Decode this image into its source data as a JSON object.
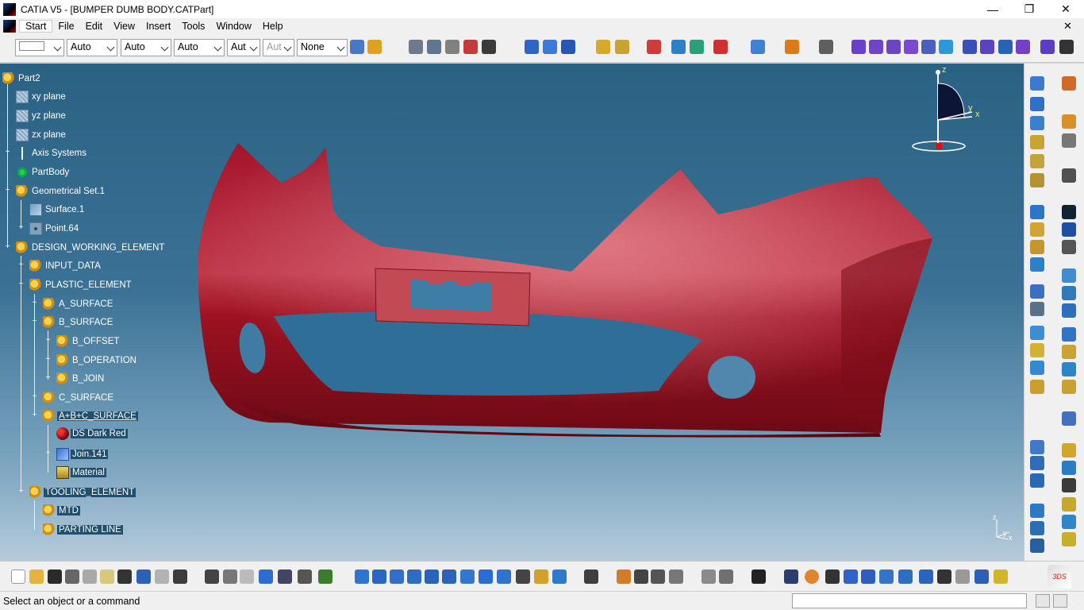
{
  "window": {
    "title": "CATIA V5 - [BUMPER DUMB BODY.CATPart]",
    "controls": {
      "minimize": "—",
      "restore": "❐",
      "close": "✕"
    }
  },
  "menu": {
    "items": [
      "Start",
      "File",
      "Edit",
      "View",
      "Insert",
      "Tools",
      "Window",
      "Help"
    ]
  },
  "toolbar": {
    "combos": [
      "",
      "Auto",
      "Auto",
      "Auto",
      "Aut",
      "Aut",
      "None"
    ]
  },
  "tree": {
    "root": "Part2",
    "nodes": [
      "xy plane",
      "yz plane",
      "zx plane",
      "Axis Systems",
      "PartBody",
      "Geometrical Set.1",
      "Surface.1",
      "Point.64",
      "DESIGN_WORKING_ELEMENT",
      "INPUT_DATA",
      "PLASTIC_ELEMENT",
      "A_SURFACE",
      "B_SURFACE",
      "B_OFFSET",
      "B_OPERATION",
      "B_JOIN",
      "C_SURFACE",
      "A+B+C_SURFACE",
      "DS Dark Red",
      "Join.141",
      "Material",
      "TOOLING_ELEMENT",
      "MTD",
      "PARTING LINE"
    ]
  },
  "compass": {
    "z": "z",
    "y": "y",
    "x": "x"
  },
  "mini_axis": {
    "z": "z",
    "y": "y",
    "x": "x"
  },
  "status": {
    "message": "Select an object or a command",
    "command_value": ""
  },
  "colors": {
    "viewport_top": "#2a6284",
    "viewport_bottom": "#b5cbdb",
    "bumper": "#8e0f1d"
  }
}
